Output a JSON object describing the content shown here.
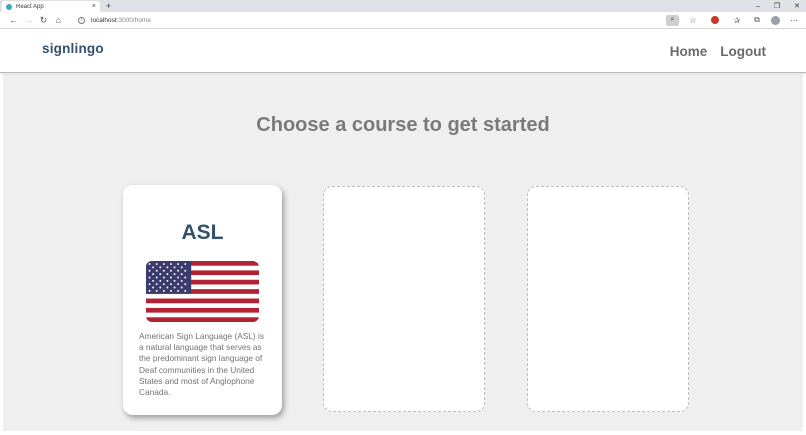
{
  "browser": {
    "tab_title": "React App",
    "tab_close": "×",
    "new_tab": "+",
    "url_host": "localhost",
    "url_path": ":3000/home",
    "win_min": "–",
    "win_max": "❐",
    "win_close": "✕"
  },
  "header": {
    "logo": "signlingo",
    "nav": [
      {
        "label": "Home"
      },
      {
        "label": "Logout"
      }
    ]
  },
  "main": {
    "heading": "Choose a course to get started",
    "courses": [
      {
        "title": "ASL",
        "flag": "us-flag",
        "description": "American Sign Language (ASL) is a natural language that serves as the predominant sign language of Deaf communities in the United States and most of Anglophone Canada."
      }
    ]
  },
  "colors": {
    "brand": "#34506b",
    "nav_text": "#6b6b6b",
    "background": "#efefef",
    "flag_red": "#b22234",
    "flag_blue": "#3c3b6e"
  }
}
